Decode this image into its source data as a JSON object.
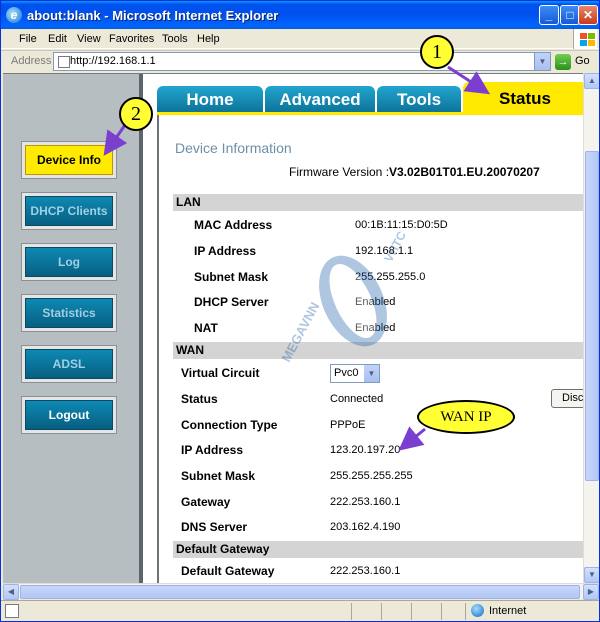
{
  "window": {
    "title": "about:blank - Microsoft Internet Explorer",
    "min_glyph": "_",
    "max_glyph": "□",
    "close_glyph": "✕"
  },
  "menu": {
    "file": "File",
    "edit": "Edit",
    "view": "View",
    "favorites": "Favorites",
    "tools": "Tools",
    "help": "Help"
  },
  "address": {
    "label": "Address",
    "url": "http://192.168.1.1",
    "go_label": "Go"
  },
  "left_nav": {
    "items": [
      {
        "label": "Device Info",
        "active": true
      },
      {
        "label": "DHCP Clients",
        "active": false
      },
      {
        "label": "Log",
        "active": false
      },
      {
        "label": "Statistics",
        "active": false
      },
      {
        "label": "ADSL",
        "active": false
      },
      {
        "label": "Logout",
        "active": false
      }
    ]
  },
  "tabs": {
    "home": "Home",
    "advanced": "Advanced",
    "tools": "Tools",
    "status": "Status"
  },
  "device_info": {
    "title": "Device Information",
    "firmware_label": "Firmware Version :",
    "firmware_value": "V3.02B01T01.EU.20070207"
  },
  "lan": {
    "section": "LAN",
    "mac_label": "MAC Address",
    "mac_value": "00:1B:11:15:D0:5D",
    "ip_label": "IP Address",
    "ip_value": "192.168.1.1",
    "mask_label": "Subnet Mask",
    "mask_value": "255.255.255.0",
    "dhcp_label": "DHCP Server",
    "dhcp_value": "Enabled",
    "nat_label": "NAT",
    "nat_value": "Enabled"
  },
  "wan": {
    "section": "WAN",
    "vc_label": "Virtual Circuit",
    "vc_value": "Pvc0",
    "status_label": "Status",
    "status_value": "Connected",
    "disconnect_button": "Disc",
    "conn_type_label": "Connection Type",
    "conn_type_value": "PPPoE",
    "ip_label": "IP Address",
    "ip_value": "123.20.197.20",
    "mask_label": "Subnet Mask",
    "mask_value": "255.255.255.255",
    "gateway_label": "Gateway",
    "gateway_value": "222.253.160.1",
    "dns_label": "DNS Server",
    "dns_value": "203.162.4.190"
  },
  "default_gateway": {
    "section": "Default Gateway",
    "label": "Default Gateway",
    "value": "222.253.160.1"
  },
  "annotations": {
    "one": "1",
    "two": "2",
    "wan_ip": "WAN IP"
  },
  "watermark": {
    "left_text": "MEGAVNN",
    "right_text": "VHTC"
  },
  "statusbar": {
    "zone": "Internet"
  },
  "colors": {
    "tab_active": "#ffe900",
    "tab_inactive": "#0e89b3",
    "nav_button": "#0e89b3",
    "section_bg": "#d4d4d4",
    "title_bar": "#0053ee"
  }
}
